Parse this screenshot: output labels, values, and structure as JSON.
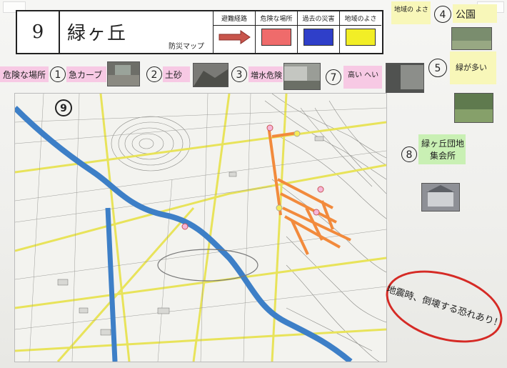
{
  "header": {
    "number": "9",
    "title": "緑ヶ丘",
    "map_word": "防災マップ",
    "legend": [
      {
        "label": "避難経路",
        "color": "#c8554c",
        "kind": "arrow"
      },
      {
        "label": "危険な場所",
        "color": "#ef6b6b",
        "kind": "swatch"
      },
      {
        "label": "過去の災害",
        "color": "#2f3fc9",
        "kind": "swatch"
      },
      {
        "label": "地域のよさ",
        "color": "#f2ee26",
        "kind": "swatch"
      }
    ]
  },
  "danger_row": {
    "heading": "危険な場所",
    "items": [
      {
        "number": "1",
        "label": "急カーブ"
      },
      {
        "number": "2",
        "label": "土砂"
      },
      {
        "number": "3",
        "label": "増水危険"
      },
      {
        "number": "7",
        "label": "高い へい"
      }
    ]
  },
  "right_notes": {
    "chiiki": "地域の よさ",
    "item4": {
      "number": "4",
      "label": "公園"
    },
    "item5": {
      "number": "5",
      "label": "緑が多い"
    },
    "item8": {
      "number": "8",
      "label": "緑ヶ丘団地 集会所"
    }
  },
  "map": {
    "marker": "9"
  },
  "warning": "地震時、倒壊する恐れあり！"
}
